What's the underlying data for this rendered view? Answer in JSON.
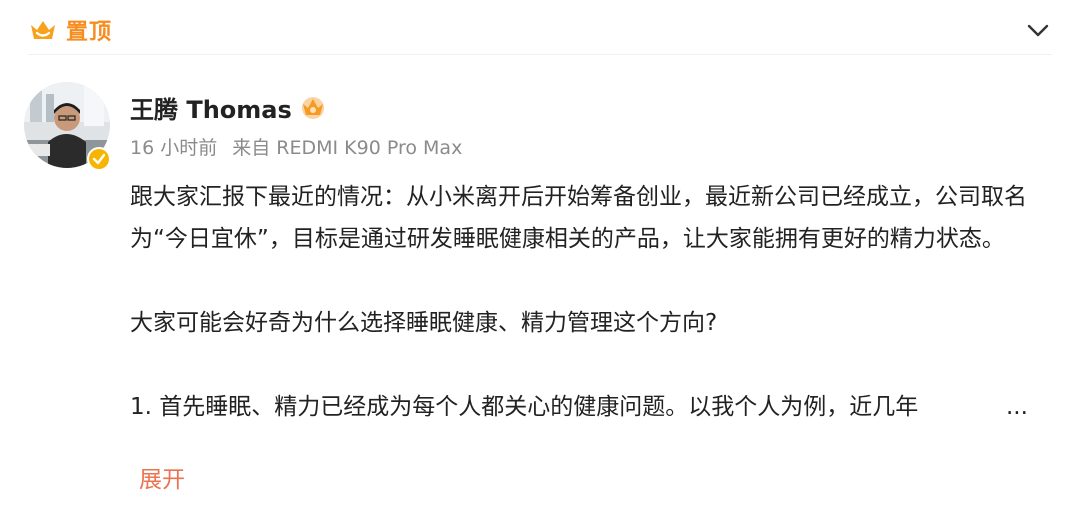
{
  "pinned": {
    "label": "置顶",
    "icon": "crown-pin-icon",
    "collapse_icon": "chevron-down-icon"
  },
  "post": {
    "author": {
      "name": "王腾 Thomas",
      "avatar_icon": "avatar",
      "verified_icon": "verified-badge-icon",
      "member_icon": "crown-member-icon"
    },
    "time": "16 小时前",
    "source": "来自 REDMI K90 Pro Max",
    "paragraph1": "跟大家汇报下最近的情况：从小米离开后开始筹备创业，最近新公司已经成立，公司取名为“今日宜休”，目标是通过研发睡眠健康相关的产品，让大家能拥有更好的精力状态。",
    "paragraph2": "大家可能会好奇为什么选择睡眠健康、精力管理这个方向?",
    "paragraph3": "1. 首先睡眠、精力已经成为每个人都关心的健康问题。以我个人为例，近几年",
    "ellipsis": "...",
    "expand_label": "展开"
  },
  "colors": {
    "accent_orange": "#f78c1f",
    "expand_link": "#eb7350",
    "meta_gray": "#8b8b8b",
    "verified_yellow": "#f7b500"
  }
}
